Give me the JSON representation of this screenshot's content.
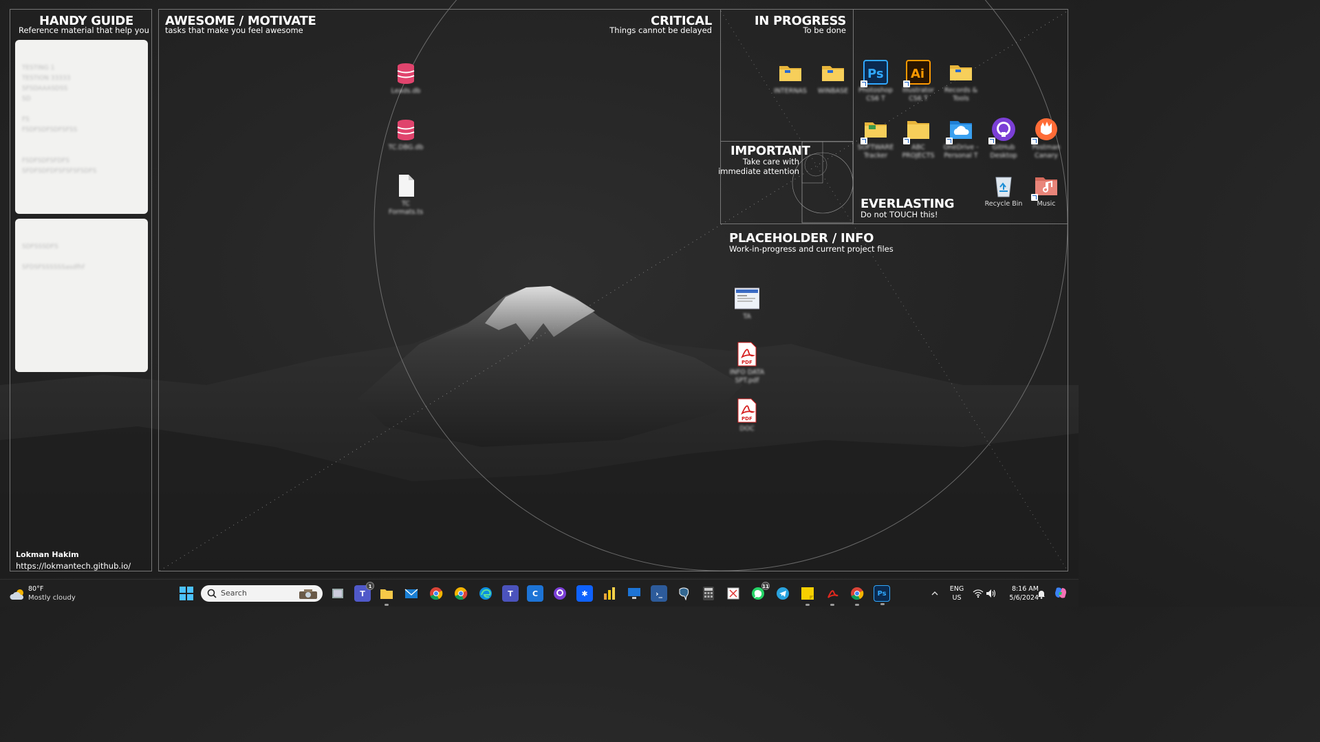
{
  "zones": {
    "handy_guide": {
      "title": "HANDY GUIDE",
      "subtitle": "Reference material that help you"
    },
    "awesome": {
      "title": "AWESOME / MOTIVATE",
      "subtitle": "tasks that make you feel awesome"
    },
    "critical": {
      "title": "CRITICAL",
      "subtitle": "Things cannot be delayed"
    },
    "in_progress": {
      "title": "IN PROGRESS",
      "subtitle": "To be done"
    },
    "important": {
      "title": "IMPORTANT",
      "subtitle_1": "Take care with",
      "subtitle_2": "immediate attention"
    },
    "everlasting": {
      "title": "EVERLASTING",
      "subtitle": "Do not TOUCH this!"
    },
    "placeholder": {
      "title": "PLACEHOLDER / INFO",
      "subtitle": "Work-in-progress and current project files"
    }
  },
  "notes": {
    "card1": [
      "TESTING 1",
      "TESTION 33333",
      "SFSDAAASDSS",
      "SD",
      "",
      "FS",
      "FSDFSDFSDFSFSS",
      "",
      "",
      "FSDFSDFSFDFS",
      "SFDFSDFDFSFSFSFSDFS"
    ],
    "card2": [
      "SDFSSSDFS",
      "",
      "SFDSFSSSSSSasdfhf"
    ]
  },
  "author": {
    "name": "Lokman Hakim",
    "url": "https://lokmantech.github.io/"
  },
  "desktop_icons": {
    "awesome": [
      {
        "name": "database-icon",
        "label": "Leads.db"
      },
      {
        "name": "database-icon",
        "label": "TC.DBG.db"
      },
      {
        "name": "blank-file-icon",
        "label": "TC",
        "label2": "Formats.ts"
      }
    ],
    "in_progress": [
      {
        "name": "folder-icon",
        "label": "INTERNAS"
      },
      {
        "name": "folder-icon",
        "label": "WINBASE"
      }
    ],
    "everlasting_row1": [
      {
        "name": "photoshop-icon",
        "label": "Photoshop",
        "label2": "CS6 T"
      },
      {
        "name": "illustrator-icon",
        "label": "Illustrator",
        "label2": "CS6 T"
      },
      {
        "name": "folder-icon",
        "label": "Records &",
        "label2": "Tools"
      }
    ],
    "everlasting_row2": [
      {
        "name": "folder-shortcut-icon",
        "label": "SOFTWARE",
        "label2": "Tracker"
      },
      {
        "name": "folder-icon",
        "label": "ABC",
        "label2": "PROJECTS"
      },
      {
        "name": "onedrive-icon",
        "label": "OneDrive -",
        "label2": "Personal T"
      },
      {
        "name": "github-desktop-icon",
        "label": "GitHub",
        "label2": "Desktop"
      },
      {
        "name": "postman-icon",
        "label": "Postman",
        "label2": "Canary"
      }
    ],
    "everlasting_row3": [
      {
        "name": "recycle-bin-icon",
        "label": "Recycle Bin"
      },
      {
        "name": "music-icon",
        "label": "Music"
      }
    ],
    "placeholder": [
      {
        "name": "screenshot-thumb-icon",
        "label": "TA"
      },
      {
        "name": "pdf-icon",
        "label": "INFO DATA",
        "label2": "SPT.pdf"
      },
      {
        "name": "pdf-icon",
        "label": "DOC"
      }
    ]
  },
  "taskbar": {
    "weather": {
      "temp": "80°F",
      "condition": "Mostly cloudy"
    },
    "search_placeholder": "Search",
    "apps": [
      "windows-start-icon",
      "task-view-icon",
      "teams-icon",
      "file-explorer-icon",
      "mail-icon",
      "chrome-icon",
      "chrome-canary-icon",
      "edge-icon",
      "teams-new-icon",
      "sourcetree-icon",
      "github-icon",
      "azure-icon",
      "power-bi-icon",
      "remote-desktop-icon",
      "powershell-icon",
      "postgres-icon",
      "calculator-icon",
      "snipping-tool-icon",
      "whatsapp-icon",
      "telegram-icon",
      "sticky-notes-icon",
      "acrobat-icon",
      "chrome-profile-icon",
      "photoshop-icon"
    ],
    "badges": {
      "teams": "1",
      "whatsapp": "11"
    },
    "lang_1": "ENG",
    "lang_2": "US",
    "time": "8:16 AM",
    "date": "5/6/2024"
  },
  "colors": {
    "background": "#262626",
    "taskbar": "#202020",
    "frame": "#777777",
    "pdf_red": "#d61f1f",
    "db_pink": "#e0446d"
  }
}
